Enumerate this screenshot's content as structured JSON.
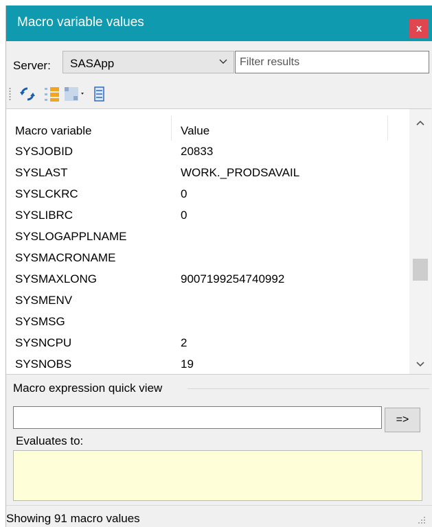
{
  "window": {
    "title": "Macro variable values",
    "close_label": "x"
  },
  "server": {
    "label": "Server:",
    "value": "SASApp"
  },
  "filter": {
    "placeholder": "Filter results",
    "value": ""
  },
  "toolbar": {
    "items": [
      {
        "name": "refresh-icon"
      },
      {
        "name": "tree-view-icon"
      },
      {
        "name": "grid-view-dropdown-icon"
      },
      {
        "name": "list-view-icon"
      }
    ]
  },
  "table": {
    "columns": [
      "Macro variable",
      "Value"
    ],
    "rows": [
      {
        "name": "SYSJOBID",
        "value": "20833"
      },
      {
        "name": "SYSLAST",
        "value": "WORK._PRODSAVAIL"
      },
      {
        "name": "SYSLCKRC",
        "value": "0"
      },
      {
        "name": "SYSLIBRC",
        "value": "0"
      },
      {
        "name": "SYSLOGAPPLNAME",
        "value": ""
      },
      {
        "name": "SYSMACRONAME",
        "value": ""
      },
      {
        "name": "SYSMAXLONG",
        "value": "9007199254740992"
      },
      {
        "name": "SYSMENV",
        "value": ""
      },
      {
        "name": "SYSMSG",
        "value": ""
      },
      {
        "name": "SYSNCPU",
        "value": "2"
      },
      {
        "name": "SYSNOBS",
        "value": "19"
      }
    ]
  },
  "quick_view": {
    "group_title": "Macro expression quick view",
    "expression": "",
    "evaluate_button": "=>",
    "evaluates_label": "Evaluates to:",
    "result": ""
  },
  "status": {
    "text": "Showing 91 macro values"
  },
  "colors": {
    "titlebar": "#0f9ab0",
    "close": "#e0464f",
    "result_bg": "#fefed8"
  }
}
